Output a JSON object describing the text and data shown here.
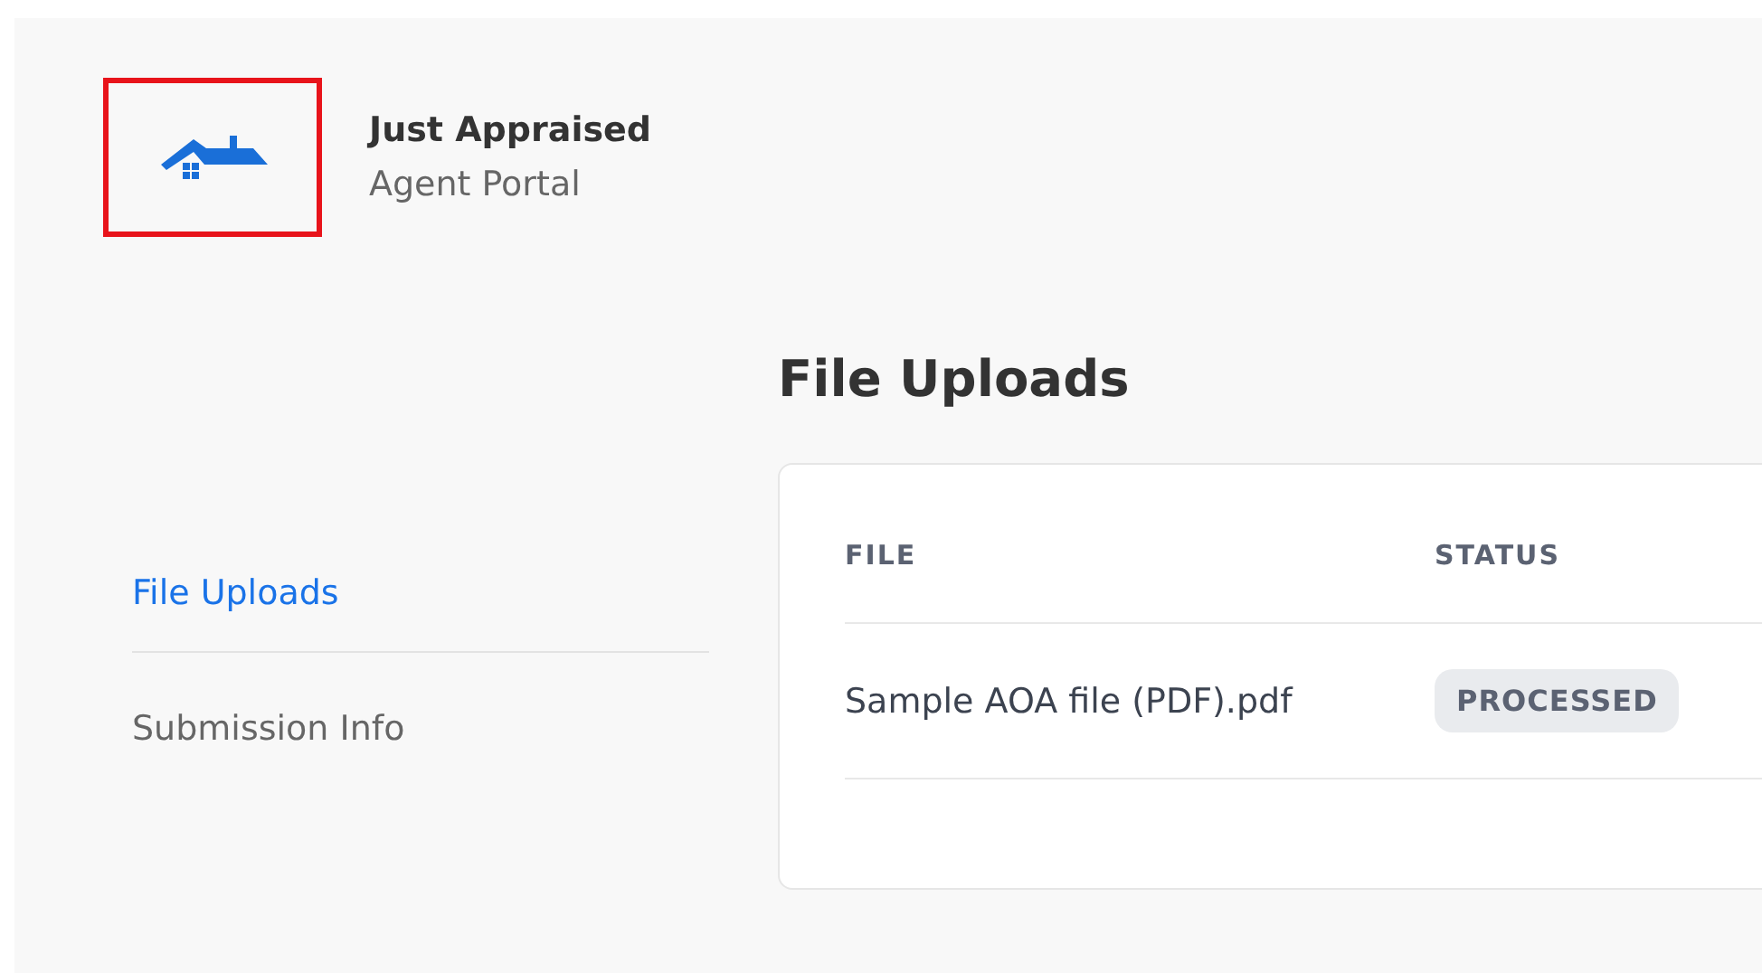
{
  "brand": {
    "title": "Just Appraised",
    "subtitle": "Agent Portal"
  },
  "sidebar": {
    "items": [
      {
        "label": "File Uploads",
        "selected": true
      },
      {
        "label": "Submission Info",
        "selected": false
      }
    ]
  },
  "page_title": "File Uploads",
  "table": {
    "columns": [
      "FILE",
      "STATUS"
    ],
    "rows": [
      {
        "file": "Sample AOA file (PDF).pdf",
        "status": "PROCESSED"
      }
    ]
  }
}
